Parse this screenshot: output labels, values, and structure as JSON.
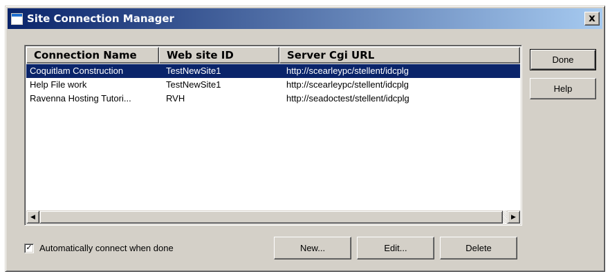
{
  "window": {
    "title": "Site Connection Manager",
    "close_label": "x"
  },
  "list": {
    "columns": [
      "Connection Name",
      "Web site ID",
      "Server Cgi URL"
    ],
    "rows": [
      {
        "name": "Coquitlam Construction",
        "site_id": "TestNewSite1",
        "url": "http://scearleypc/stellent/idcplg",
        "selected": true
      },
      {
        "name": "Help File work",
        "site_id": "TestNewSite1",
        "url": "http://scearleypc/stellent/idcplg",
        "selected": false
      },
      {
        "name": "Ravenna Hosting Tutori...",
        "site_id": "RVH",
        "url": "http://seadoctest/stellent/idcplg",
        "selected": false
      }
    ],
    "scroll_left_glyph": "◀",
    "scroll_right_glyph": "▶"
  },
  "buttons": {
    "done": "Done",
    "help": "Help",
    "new": "New...",
    "edit": "Edit...",
    "delete": "Delete"
  },
  "auto_connect": {
    "label": "Automatically connect when done",
    "checked": true,
    "check_glyph": "✓"
  },
  "colors": {
    "selection": "#0a246a",
    "title_gradient_start": "#0a246a",
    "title_gradient_end": "#a6caf0",
    "face": "#d4d0c8"
  }
}
